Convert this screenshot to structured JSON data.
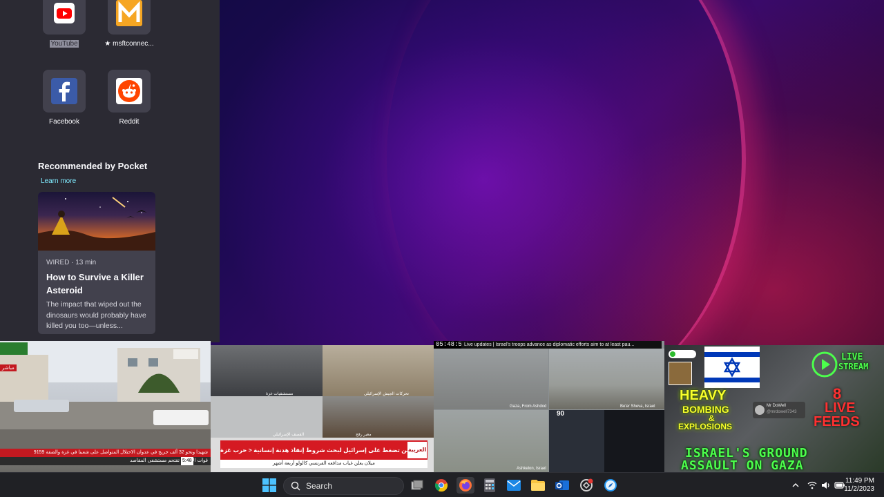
{
  "top_sites": [
    {
      "label": "YouTube",
      "icon": "youtube-icon"
    },
    {
      "label": "★ msftconnec...",
      "icon": "msft-m-icon"
    },
    {
      "label": "Facebook",
      "icon": "facebook-icon"
    },
    {
      "label": "Reddit",
      "icon": "reddit-icon"
    }
  ],
  "pocket": {
    "heading": "Recommended by Pocket",
    "learn_more": "Learn more",
    "card": {
      "meta": "WIRED · 13 min",
      "headline": "How to Survive a Killer Asteroid",
      "excerpt": "The impact that wiped out the dinosaurs would probably have killed you too—unless..."
    }
  },
  "thumbnails": {
    "t1": {
      "channel_tag": "مباشر",
      "ticker_red": "9159 شهيدا ونحو 32 ألف جريح في عدوان الاحتلال المتواصل على شعبنا في غزة والضفة",
      "ticker_dark": "قوات الاحتلال تقتحم مستشفى المقاصد",
      "time": "5:48"
    },
    "t2": {
      "caption_1": "مستشفيات غزة",
      "caption_2": "تحركات الجيش الإسرائيلي",
      "caption_3": "القصف الإسرائيلي",
      "caption_4": "معبر رفح",
      "banner": "إعلام فلسطيني: واشنطن تضغط على إسرائيل لبحث شروط إنفاذ هدنة إنسانية < حرب غزة",
      "sub": "ميلان يعلن غياب مدافعه الفرنسي كالولو أربعة أشهر",
      "logo": "العربية"
    },
    "t3": {
      "clock": "05:48:56",
      "live_bar": "Live updates | Israel's troops advance as diplomatic efforts aim to at least pau...",
      "cell_1": "Gaza, From Ashdod",
      "cell_2": "Be'er Sheva, Israel",
      "cell_3": "Ashkelon, Israel",
      "number": "90"
    },
    "t4": {
      "live_stream_1": "LIVE",
      "live_stream_2": "STREAM",
      "heavy": "HEAVY",
      "bombing": "BOMBING",
      "amp": "&",
      "explosions": "EXPLOSIONS",
      "count": "8",
      "live": "LIVE",
      "feeds": "FEEDS",
      "user": "Mr DoWell",
      "handle": "@mrdowell7343",
      "headline_1": "ISRAEL'S GROUND",
      "headline_2": "ASSAULT ON GAZA"
    }
  },
  "taskbar": {
    "search_label": "Search",
    "time": "11:49 PM",
    "date": "11/2/2023"
  },
  "colors": {
    "panel_bg": "#2b2a33",
    "tile_bg": "#42414d",
    "link": "#80ebff",
    "taskbar_bg": "#202125"
  }
}
